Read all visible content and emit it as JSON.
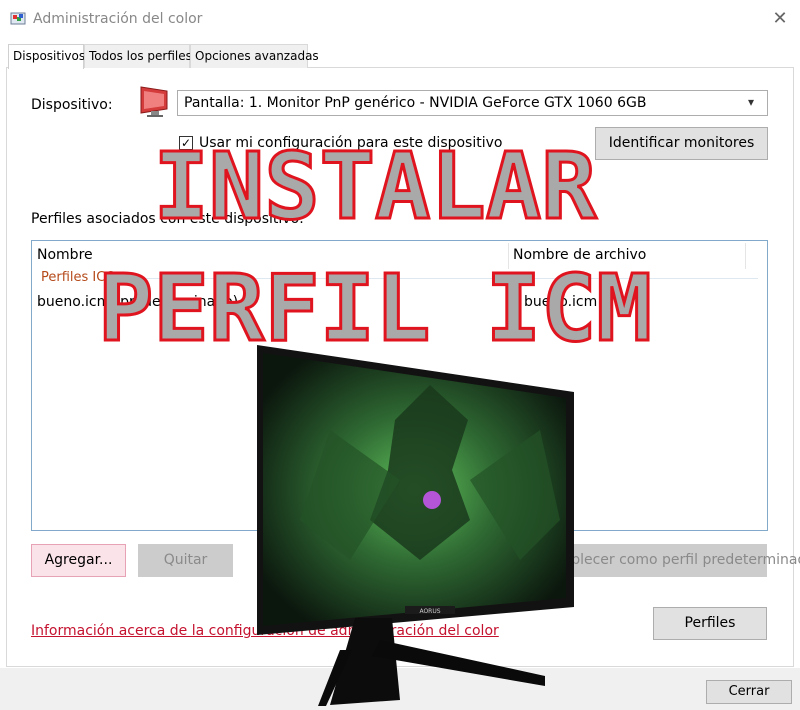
{
  "window": {
    "title": "Administración del color",
    "close_glyph": "✕"
  },
  "tabs": [
    {
      "label": "Dispositivos"
    },
    {
      "label": "Todos los perfiles"
    },
    {
      "label": "Opciones avanzadas"
    }
  ],
  "device": {
    "label": "Dispositivo:",
    "selected": "Pantalla: 1. Monitor PnP genérico - NVIDIA GeForce GTX 1060 6GB",
    "checkbox_label": "Usar mi configuración para este dispositivo",
    "checkbox_checked": true,
    "identify_button": "Identificar monitores"
  },
  "profiles": {
    "label": "Perfiles asociados con este dispositivo:",
    "columns": [
      "Nombre",
      "Nombre de archivo"
    ],
    "group": "Perfiles ICC",
    "rows": [
      {
        "name": "bueno.icm (predeterminado)",
        "file": "bueno.icm"
      }
    ]
  },
  "buttons": {
    "add": "Agregar...",
    "remove": "Quitar",
    "set_default": "Establecer como perfil predeterminado",
    "profiles": "Perfiles",
    "close": "Cerrar"
  },
  "info_link": "Información acerca de la configuración de administración del color",
  "overlay": {
    "line1": "INSTALAR",
    "line2": "PERFIL ICM",
    "monitor_brand": "AORUS"
  },
  "colors": {
    "overlay_text_fill": "#a9a9a9",
    "overlay_text_stroke": "#e0141e",
    "link": "#c4122f"
  }
}
